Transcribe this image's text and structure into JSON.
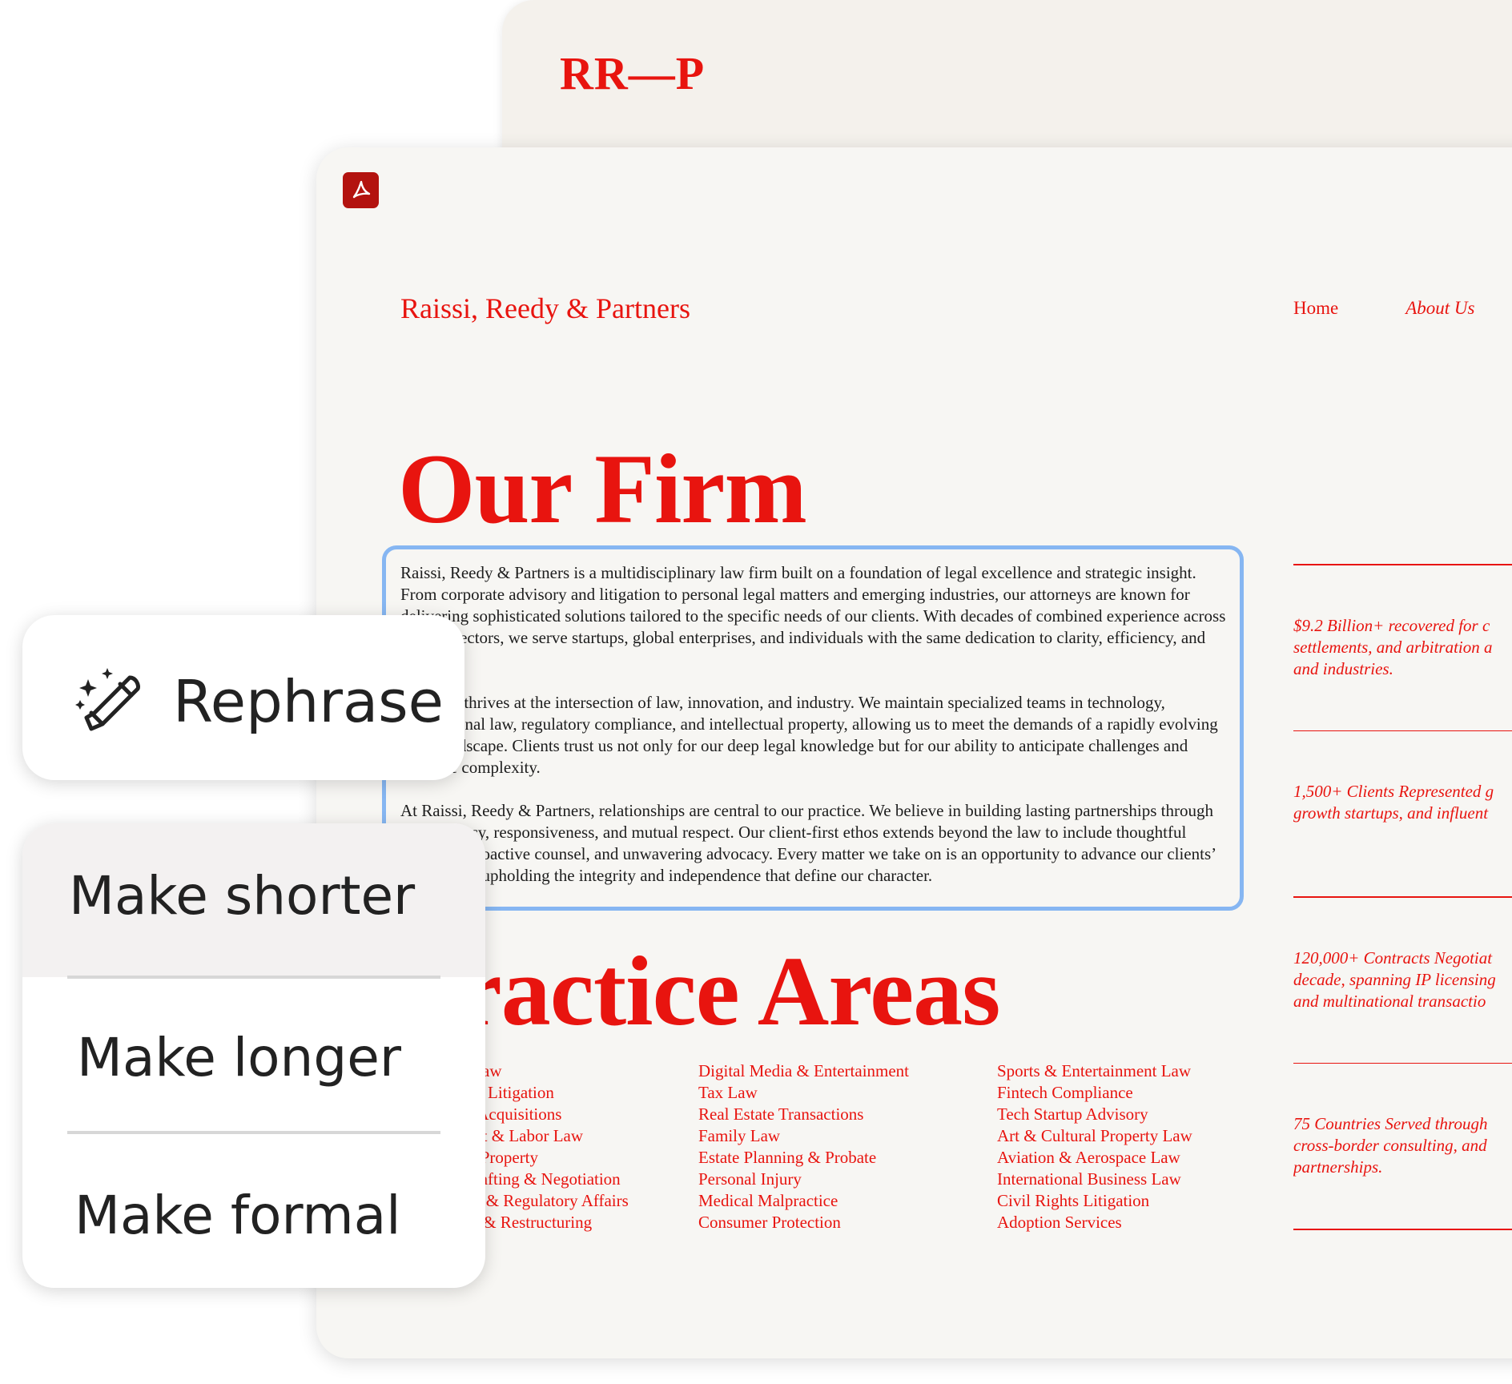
{
  "back_page": {
    "logo": "RR—P"
  },
  "doc": {
    "app_icon": "acrobat-pdf-icon",
    "firm_name": "Raissi, Reedy & Partners",
    "nav": {
      "home": "Home",
      "about": "About Us"
    },
    "heading_firm": "Our Firm",
    "paragraphs": [
      "Raissi, Reedy & Partners is a multidisciplinary law firm built on a foundation of legal excellence and strategic insight. From corporate advisory and litigation to personal legal matters and emerging industries, our attorneys are known for delivering sophisticated solutions tailored to the specific needs of our clients. With decades of combined experience across diverse sectors, we serve startups, global enterprises, and individuals with the same dedication to clarity, efficiency, and results.",
      "Our firm thrives at the intersection of law, innovation, and industry. We maintain specialized teams in technology, international law, regulatory compliance, and intellectual property, allowing us to meet the demands of a rapidly evolving legal landscape. Clients trust us not only for our deep legal knowledge but for our ability to anticipate challenges and navigate complexity.",
      "At Raissi, Reedy & Partners, relationships are central to our practice. We believe in building lasting partnerships through transparency, responsiveness, and mutual respect. Our client-first ethos extends beyond the law to include thoughtful planning, proactive counsel, and unwavering advocacy. Every matter we take on is an opportunity to advance our clients’ goals while upholding the integrity and independence that define our character."
    ],
    "heading_areas": "Practice Areas",
    "practice_areas": [
      [
        "Corporate Law",
        "Commercial Litigation",
        "Mergers & Acquisitions",
        "Employment & Labor Law",
        "Intellectual Property",
        "Contract Drafting & Negotiation",
        "Compliance & Regulatory Affairs",
        "Bankruptcy & Restructuring"
      ],
      [
        "Digital Media & Entertainment",
        "Tax Law",
        "Real Estate Transactions",
        "Family Law",
        "Estate Planning & Probate",
        "Personal Injury",
        "Medical Malpractice",
        "Consumer Protection"
      ],
      [
        "Sports & Entertainment Law",
        "Fintech Compliance",
        "Tech Startup Advisory",
        "Art & Cultural Property Law",
        "Aviation & Aerospace Law",
        "International Business Law",
        "Civil Rights Litigation",
        "Adoption Services"
      ]
    ],
    "stats": [
      [
        "$9.2 Billion+ recovered for c",
        "settlements, and arbitration a",
        "and industries."
      ],
      [
        "1,500+ Clients Represented g",
        "growth startups, and influent"
      ],
      [
        "120,000+ Contracts Negotiat",
        "decade, spanning IP licensing",
        "and multinational transactio"
      ],
      [
        "75 Countries Served through",
        "cross-border consulting, and",
        "partnerships."
      ]
    ]
  },
  "ai_panel": {
    "rephrase_icon": "magic-pencil-icon",
    "rephrase_label": "Rephrase",
    "options": [
      "Make shorter",
      "Make longer",
      "Make formal"
    ]
  }
}
